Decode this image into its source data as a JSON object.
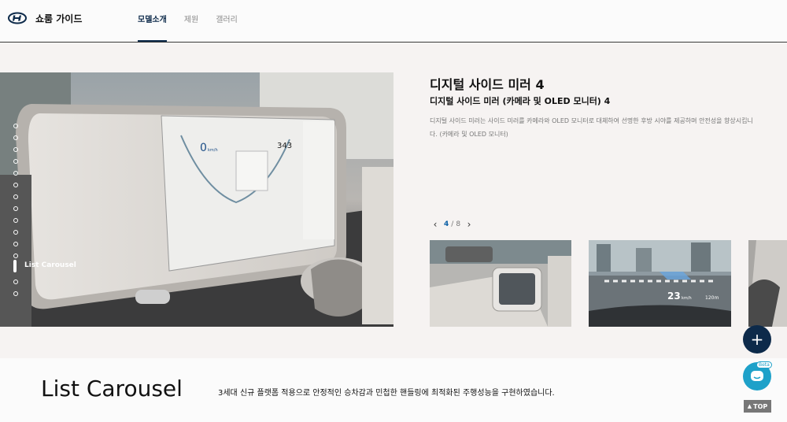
{
  "header": {
    "brand_title": "쇼룸 가이드",
    "nav": [
      {
        "label": "모델소개",
        "active": true
      },
      {
        "label": "제원",
        "active": false
      },
      {
        "label": "갤러리",
        "active": false
      }
    ]
  },
  "side_nav": {
    "active_label": "List Carousel",
    "dots_before_active": 12,
    "dots_after_active": 2
  },
  "hero": {
    "screen_speed": "0",
    "screen_speed_unit": "km/h",
    "screen_temp": "343"
  },
  "feature": {
    "title": "디지털 사이드 미러 4",
    "subtitle": "디지털 사이드 미러 (카메라 및 OLED 모니터) 4",
    "description": "디지털 사이드 미러는 사이드 미러를 카메라와 OLED 모니터로 대체하여 선명한 후방 시야를 제공하며 안전성을 향상시킵니다. (카메라 및 OLED 모니터)"
  },
  "pager": {
    "current": "4",
    "separator": "/",
    "total": "8",
    "prev_icon": "chevron-left-icon",
    "next_icon": "chevron-right-icon"
  },
  "thumbnails": [
    {
      "name": "thumb-digital-side-mirror"
    },
    {
      "name": "thumb-hud-speed",
      "speed": "23",
      "unit": "km/h",
      "distance": "120m"
    },
    {
      "name": "thumb-partial"
    }
  ],
  "floating": {
    "plus_icon": "plus-icon",
    "beta_label": "Beta",
    "top_label": "TOP"
  },
  "bottom": {
    "title": "List Carousel",
    "description": "3세대 신규 플랫폼 적용으로 안정적인 승차감과 민첩한 핸들링에 최적화된 주행성능을 구현하였습니다."
  },
  "colors": {
    "brand_navy": "#0d2a4a",
    "pager_accent": "#0b5fa5",
    "chat_blue": "#1ea1c9"
  }
}
